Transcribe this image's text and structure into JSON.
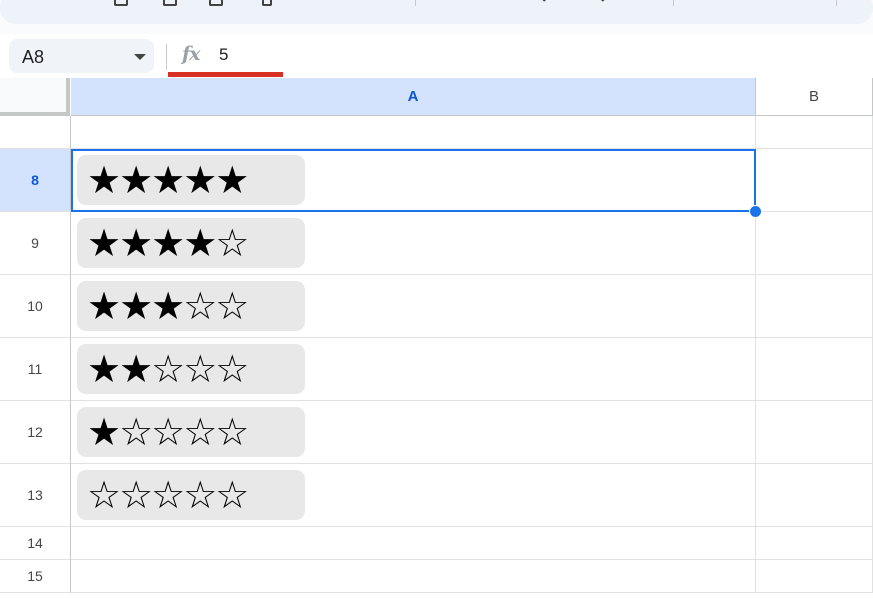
{
  "formula_bar": {
    "cell_reference": "A8",
    "fx_label": "fx",
    "value": "5"
  },
  "columns": [
    {
      "id": "a",
      "label": "A"
    },
    {
      "id": "b",
      "label": "B"
    }
  ],
  "rows": [
    {
      "number": "",
      "rating": ""
    },
    {
      "number": "8",
      "rating": "★★★★★"
    },
    {
      "number": "9",
      "rating": "★★★★☆"
    },
    {
      "number": "10",
      "rating": "★★★☆☆"
    },
    {
      "number": "11",
      "rating": "★★☆☆☆"
    },
    {
      "number": "12",
      "rating": "★☆☆☆☆"
    },
    {
      "number": "13",
      "rating": "☆☆☆☆☆"
    },
    {
      "number": "14",
      "rating": ""
    },
    {
      "number": "15",
      "rating": ""
    }
  ],
  "selection": {
    "cell": "A8"
  },
  "colors": {
    "selection_blue": "#1a73e8",
    "header_selected_bg": "#d3e3fd",
    "chip_bg": "#e8e8e8",
    "formula_underline": "#d93025"
  }
}
